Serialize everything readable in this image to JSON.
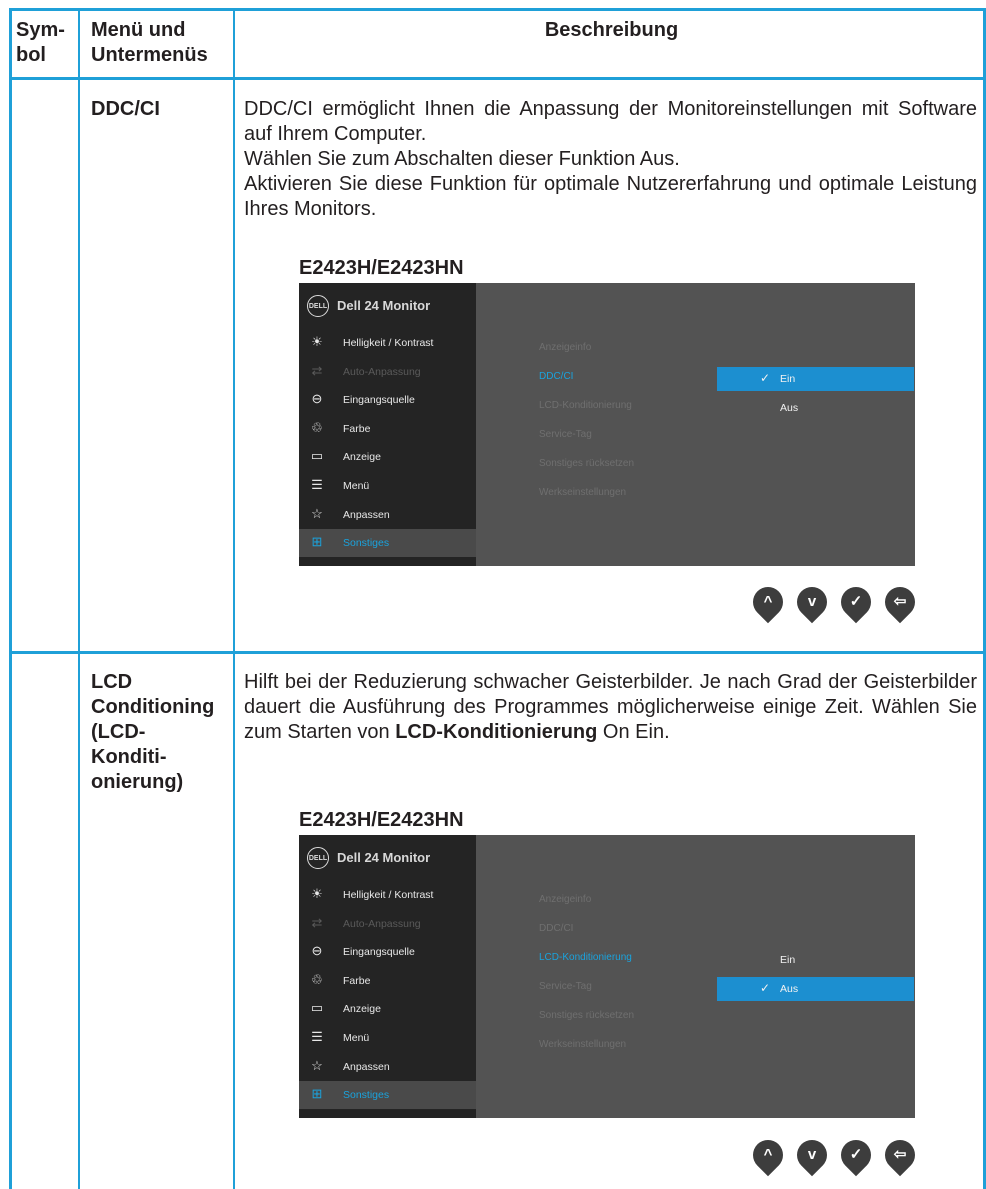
{
  "header": {
    "col1": [
      "Sym-",
      "bol"
    ],
    "col2": [
      "Menü und",
      "Untermenüs"
    ],
    "col3": "Beschreibung"
  },
  "rows": [
    {
      "name_lines": [
        "DDC/CI"
      ],
      "description": [
        "DDC/CI ermöglicht Ihnen die Anpassung der Monitoreinstellungen mit Software auf Ihrem Computer.",
        "Wählen Sie zum Abschalten dieser Funktion Aus.",
        "Aktivieren Sie diese Funktion für optimale Nutzererfahrung und optimale Leistung Ihres Monitors."
      ],
      "model": "E2423H/E2423HN",
      "osd": {
        "title": "Dell 24 Monitor",
        "logo": "DELL",
        "menu": [
          {
            "icon": "brightness-icon",
            "glyph": "☀",
            "label": "Helligkeit / Kontrast",
            "state": "normal"
          },
          {
            "icon": "auto-adjust-icon",
            "glyph": "⇄",
            "label": "Auto-Anpassung",
            "state": "disabled"
          },
          {
            "icon": "input-source-icon",
            "glyph": "⊖",
            "label": "Eingangsquelle",
            "state": "normal"
          },
          {
            "icon": "color-icon",
            "glyph": "♲",
            "label": "Farbe",
            "state": "normal"
          },
          {
            "icon": "display-icon",
            "glyph": "▭",
            "label": "Anzeige",
            "state": "normal"
          },
          {
            "icon": "menu-icon",
            "glyph": "☰",
            "label": "Menü",
            "state": "normal"
          },
          {
            "icon": "personalize-icon",
            "glyph": "☆",
            "label": "Anpassen",
            "state": "normal"
          },
          {
            "icon": "others-icon",
            "glyph": "⊞",
            "label": "Sonstiges",
            "state": "active"
          }
        ],
        "submenu": [
          "Anzeigeinfo",
          "DDC/CI",
          "LCD-Konditionierung",
          "Service-Tag",
          "Sonstiges rücksetzen",
          "Werkseinstellungen"
        ],
        "submenu_selected": 1,
        "options": [
          "Ein",
          "Aus"
        ],
        "option_selected": 0
      }
    },
    {
      "name_lines": [
        "LCD",
        "Conditioning",
        "(LCD-",
        "Konditi-",
        "onierung)"
      ],
      "description_parts": {
        "a": "Hilft bei der Reduzierung schwacher Geisterbilder. Je nach Grad der Geisterbilder dauert die Ausführung des Programmes möglicherweise einige Zeit. Wählen Sie zum Starten von ",
        "b": "LCD-Konditionierung",
        "c": " On Ein."
      },
      "model": "E2423H/E2423HN",
      "osd": {
        "title": "Dell 24 Monitor",
        "logo": "DELL",
        "submenu_selected": 2,
        "options": [
          "Ein",
          "Aus"
        ],
        "option_selected": 1
      }
    }
  ],
  "nav_buttons": [
    {
      "icon": "up-arrow-icon",
      "glyph": "^"
    },
    {
      "icon": "down-arrow-icon",
      "glyph": "v"
    },
    {
      "icon": "checkmark-icon",
      "glyph": "✓"
    },
    {
      "icon": "back-icon",
      "glyph": "⇦"
    }
  ],
  "colors": {
    "table_border": "#1fa0d8",
    "osd_bg": "#535353",
    "osd_sidebar": "#242424",
    "accent": "#1aa3dd",
    "option_highlight": "#1c8fd0"
  }
}
